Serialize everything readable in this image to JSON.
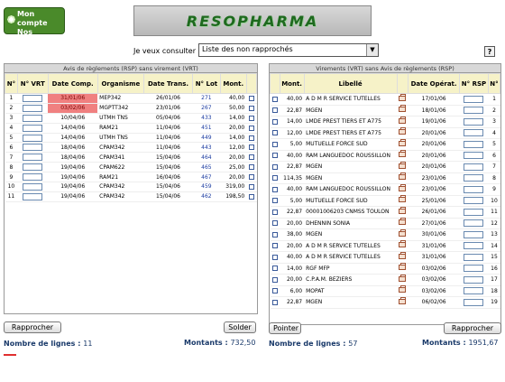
{
  "top_button": {
    "line1": "Mon compte",
    "line2": "Nos options"
  },
  "logo": "RESOPHARMA",
  "consult": {
    "label": "Je veux consulter",
    "selected": "Liste des non rapprochés",
    "help": "?"
  },
  "left": {
    "title": "Avis de règlements (RSP) sans virement (VRT)",
    "headers": {
      "num": "N°",
      "vrt": "N° VRT",
      "date": "Date Comp.",
      "org": "Organisme",
      "dtrans": "Date Trans.",
      "lot": "N° Lot",
      "mont": "Mont."
    },
    "rows": [
      {
        "num": "1",
        "date": "31/01/06",
        "org": "MEP342",
        "dtrans": "26/01/06",
        "lot": "271",
        "mont": "40,00",
        "red": true
      },
      {
        "num": "2",
        "date": "03/02/06",
        "org": "MGPTT342",
        "dtrans": "23/01/06",
        "lot": "267",
        "mont": "50,00",
        "red": true
      },
      {
        "num": "3",
        "date": "10/04/06",
        "org": "UTMH TNS",
        "dtrans": "05/04/06",
        "lot": "433",
        "mont": "14,00",
        "red": false
      },
      {
        "num": "4",
        "date": "14/04/06",
        "org": "RAM21",
        "dtrans": "11/04/06",
        "lot": "451",
        "mont": "20,00",
        "red": false
      },
      {
        "num": "5",
        "date": "14/04/06",
        "org": "UTMH TNS",
        "dtrans": "11/04/06",
        "lot": "449",
        "mont": "14,00",
        "red": false
      },
      {
        "num": "6",
        "date": "18/04/06",
        "org": "CPAM342",
        "dtrans": "11/04/06",
        "lot": "443",
        "mont": "12,00",
        "red": false
      },
      {
        "num": "7",
        "date": "18/04/06",
        "org": "CPAM341",
        "dtrans": "15/04/06",
        "lot": "464",
        "mont": "20,00",
        "red": false
      },
      {
        "num": "8",
        "date": "19/04/06",
        "org": "CPAM622",
        "dtrans": "15/04/06",
        "lot": "465",
        "mont": "25,00",
        "red": false
      },
      {
        "num": "9",
        "date": "19/04/06",
        "org": "RAM21",
        "dtrans": "16/04/06",
        "lot": "467",
        "mont": "20,00",
        "red": false
      },
      {
        "num": "10",
        "date": "19/04/06",
        "org": "CPAM342",
        "dtrans": "15/04/06",
        "lot": "459",
        "mont": "319,00",
        "red": false
      },
      {
        "num": "11",
        "date": "19/04/06",
        "org": "CPAM342",
        "dtrans": "15/04/06",
        "lot": "462",
        "mont": "198,50",
        "red": false
      }
    ],
    "btn_rapprocher": "Rapprocher",
    "btn_solder": "Solder",
    "nb_label": "Nombre de lignes :",
    "nb_value": "11",
    "montants_label": "Montants :",
    "montants_value": "732,50"
  },
  "right": {
    "title": "Virements (VRT) sans Avis de règlements (RSP)",
    "headers": {
      "mont": "Mont.",
      "libelle": "Libellé",
      "date": "Date Opérat.",
      "rsp": "N° RSP",
      "num": "N°"
    },
    "rows": [
      {
        "mont": "40,00",
        "lib": "A D M R SERVICE TUTELLES",
        "date": "17/01/06",
        "num": "1"
      },
      {
        "mont": "22,87",
        "lib": "MGEN",
        "date": "18/01/06",
        "num": "2"
      },
      {
        "mont": "14,00",
        "lib": "LMDE PREST TIERS ET A775",
        "date": "19/01/06",
        "num": "3"
      },
      {
        "mont": "12,00",
        "lib": "LMDE PREST TIERS ET A775",
        "date": "20/01/06",
        "num": "4"
      },
      {
        "mont": "5,00",
        "lib": "MUTUELLE FORCE SUD",
        "date": "20/01/06",
        "num": "5"
      },
      {
        "mont": "40,00",
        "lib": "RAM LANGUEDOC ROUSSILLON",
        "date": "20/01/06",
        "num": "6"
      },
      {
        "mont": "22,87",
        "lib": "MGEN",
        "date": "20/01/06",
        "num": "7"
      },
      {
        "mont": "114,35",
        "lib": "MGEN",
        "date": "23/01/06",
        "num": "8"
      },
      {
        "mont": "40,00",
        "lib": "RAM LANGUEDOC ROUSSILLON",
        "date": "23/01/06",
        "num": "9"
      },
      {
        "mont": "5,00",
        "lib": "MUTUELLE FORCE SUD",
        "date": "25/01/06",
        "num": "10"
      },
      {
        "mont": "22,87",
        "lib": "00001006203 CNMSS TOULON",
        "date": "26/01/06",
        "num": "11"
      },
      {
        "mont": "20,00",
        "lib": "DHENNIN SONIA",
        "date": "27/01/06",
        "num": "12"
      },
      {
        "mont": "38,00",
        "lib": "MGEN",
        "date": "30/01/06",
        "num": "13"
      },
      {
        "mont": "20,00",
        "lib": "A D M R SERVICE TUTELLES",
        "date": "31/01/06",
        "num": "14"
      },
      {
        "mont": "40,00",
        "lib": "A D M R SERVICE TUTELLES",
        "date": "31/01/06",
        "num": "15"
      },
      {
        "mont": "14,00",
        "lib": "RGF MFP",
        "date": "03/02/06",
        "num": "16"
      },
      {
        "mont": "20,00",
        "lib": "C.P.A.M. BEZIERS",
        "date": "03/02/06",
        "num": "17"
      },
      {
        "mont": "6,00",
        "lib": "MOPAT",
        "date": "03/02/06",
        "num": "18"
      },
      {
        "mont": "22,87",
        "lib": "MGEN",
        "date": "06/02/06",
        "num": "19"
      }
    ],
    "btn_pointer": "Pointer",
    "btn_rapprocher": "Rapprocher",
    "nb_label": "Nombre de lignes :",
    "nb_value": "57",
    "montants_label": "Montants :",
    "montants_value": "1951,67"
  }
}
